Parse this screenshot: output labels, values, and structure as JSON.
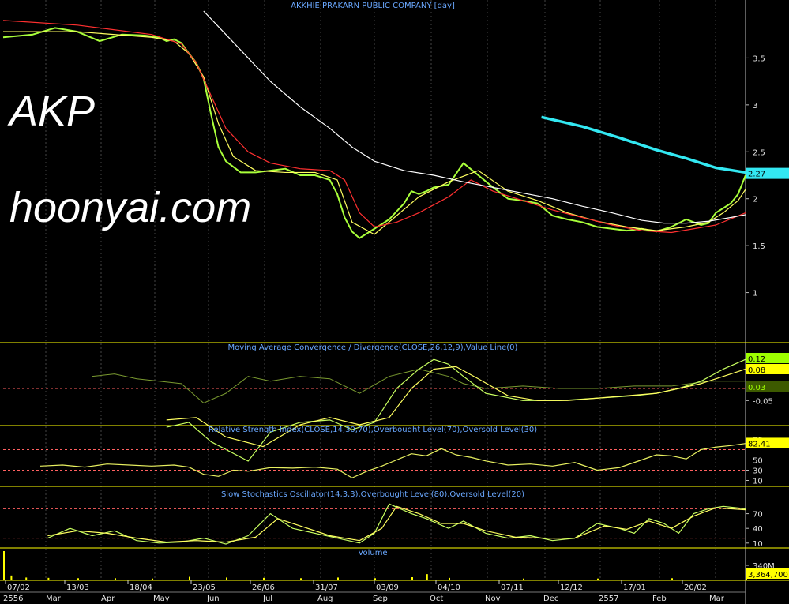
{
  "watermark": {
    "ticker": "AKP",
    "site": "hoonyai.com"
  },
  "chart_data": [
    {
      "type": "line",
      "panel": "price",
      "title": "AKKHIE PRAKARN PUBLIC COMPANY [day]",
      "ylim": [
        0.5,
        4.0
      ],
      "yticks": [
        {
          "v": 3.5,
          "t": "3.5"
        },
        {
          "v": 3,
          "t": "3"
        },
        {
          "v": 2.5,
          "t": "2.5"
        },
        {
          "v": 2,
          "t": "2"
        },
        {
          "v": 1.5,
          "t": "1.5"
        },
        {
          "v": 1,
          "t": "1"
        }
      ],
      "last_value_label": "2.27",
      "last_value": 2.27,
      "series": [
        {
          "role": "close",
          "color": "#a9ff3a",
          "x": [
            0,
            0.04,
            0.07,
            0.1,
            0.13,
            0.16,
            0.19,
            0.21,
            0.22,
            0.23,
            0.24,
            0.25,
            0.26,
            0.27,
            0.28,
            0.29,
            0.3,
            0.32,
            0.34,
            0.36,
            0.38,
            0.4,
            0.42,
            0.44,
            0.45,
            0.46,
            0.47,
            0.48,
            0.5,
            0.52,
            0.54,
            0.55,
            0.56,
            0.57,
            0.58,
            0.6,
            0.62,
            0.64,
            0.66,
            0.68,
            0.7,
            0.72,
            0.74,
            0.76,
            0.78,
            0.8,
            0.82,
            0.84,
            0.86,
            0.88,
            0.9,
            0.92,
            0.94,
            0.95,
            0.96,
            0.97,
            0.98,
            0.99,
            1.0
          ],
          "y": [
            3.72,
            3.75,
            3.82,
            3.78,
            3.68,
            3.75,
            3.74,
            3.72,
            3.68,
            3.7,
            3.66,
            3.55,
            3.45,
            3.28,
            2.9,
            2.55,
            2.4,
            2.28,
            2.28,
            2.3,
            2.32,
            2.25,
            2.25,
            2.2,
            2.05,
            1.8,
            1.65,
            1.58,
            1.68,
            1.78,
            1.95,
            2.08,
            2.05,
            2.08,
            2.12,
            2.15,
            2.38,
            2.25,
            2.12,
            2.0,
            1.98,
            1.95,
            1.82,
            1.78,
            1.75,
            1.7,
            1.68,
            1.66,
            1.68,
            1.65,
            1.7,
            1.78,
            1.72,
            1.74,
            1.85,
            1.9,
            1.95,
            2.05,
            2.25
          ]
        },
        {
          "role": "ma-short",
          "color": "#ffff60",
          "x": [
            0,
            0.1,
            0.2,
            0.23,
            0.25,
            0.27,
            0.29,
            0.31,
            0.34,
            0.38,
            0.42,
            0.45,
            0.47,
            0.5,
            0.53,
            0.56,
            0.58,
            0.6,
            0.64,
            0.68,
            0.72,
            0.76,
            0.8,
            0.84,
            0.88,
            0.92,
            0.95,
            0.97,
            0.99,
            1.0
          ],
          "y": [
            3.78,
            3.78,
            3.72,
            3.68,
            3.55,
            3.3,
            2.8,
            2.45,
            2.3,
            2.28,
            2.28,
            2.2,
            1.75,
            1.62,
            1.82,
            2.02,
            2.1,
            2.18,
            2.3,
            2.08,
            1.98,
            1.85,
            1.76,
            1.7,
            1.66,
            1.7,
            1.75,
            1.85,
            1.98,
            2.1
          ]
        },
        {
          "role": "ma-mid",
          "color": "#ff3030",
          "x": [
            0,
            0.1,
            0.2,
            0.24,
            0.26,
            0.28,
            0.3,
            0.33,
            0.36,
            0.4,
            0.44,
            0.46,
            0.48,
            0.5,
            0.53,
            0.56,
            0.6,
            0.63,
            0.66,
            0.7,
            0.74,
            0.78,
            0.82,
            0.86,
            0.9,
            0.93,
            0.96,
            1.0
          ],
          "y": [
            3.9,
            3.85,
            3.75,
            3.65,
            3.45,
            3.1,
            2.75,
            2.5,
            2.38,
            2.32,
            2.3,
            2.2,
            1.85,
            1.7,
            1.75,
            1.85,
            2.02,
            2.2,
            2.08,
            1.98,
            1.88,
            1.8,
            1.72,
            1.66,
            1.64,
            1.68,
            1.72,
            1.85
          ]
        },
        {
          "role": "ma-long",
          "color": "#ffffff",
          "x": [
            0.27,
            0.3,
            0.33,
            0.36,
            0.4,
            0.44,
            0.47,
            0.5,
            0.54,
            0.58,
            0.62,
            0.66,
            0.7,
            0.74,
            0.78,
            0.82,
            0.86,
            0.89,
            0.92,
            0.95,
            0.98,
            1.0
          ],
          "y": [
            4.0,
            3.75,
            3.5,
            3.25,
            2.98,
            2.75,
            2.55,
            2.4,
            2.3,
            2.25,
            2.18,
            2.12,
            2.06,
            2.0,
            1.92,
            1.85,
            1.77,
            1.74,
            1.74,
            1.76,
            1.8,
            1.83
          ]
        },
        {
          "role": "trend-line",
          "color": "#33e8f2",
          "x": [
            0.725,
            0.78,
            0.83,
            0.88,
            0.92,
            0.96,
            1.0
          ],
          "y": [
            2.87,
            2.77,
            2.65,
            2.52,
            2.43,
            2.33,
            2.28
          ]
        }
      ]
    },
    {
      "type": "line",
      "panel": "macd",
      "title": "Moving Average Convergence / Divergence(CLOSE,26,12,9),Value Line(0)",
      "ylim": [
        -0.15,
        0.15
      ],
      "yticks": [
        {
          "v": -0.05,
          "t": "-0.05"
        }
      ],
      "value_labels": [
        {
          "t": "0.12",
          "v": 0.12,
          "bg": "#9eff00",
          "fg": "#000000"
        },
        {
          "t": "0.08",
          "v": 0.08,
          "bg": "#ffff00",
          "fg": "#000000"
        },
        {
          "t": "0.03",
          "v": 0.03,
          "bg": "#3d5a00",
          "fg": "#9eff00"
        }
      ],
      "reference_line": 0,
      "series": [
        {
          "role": "histogram",
          "color": "#7a9a30",
          "x": [
            0.12,
            0.15,
            0.18,
            0.21,
            0.24,
            0.27,
            0.3,
            0.33,
            0.36,
            0.4,
            0.44,
            0.48,
            0.52,
            0.56,
            0.6,
            0.62,
            0.65,
            0.7,
            0.75,
            0.8,
            0.85,
            0.9,
            0.95,
            1.0
          ],
          "y": [
            0.05,
            0.06,
            0.04,
            0.03,
            0.02,
            -0.06,
            -0.02,
            0.05,
            0.03,
            0.05,
            0.04,
            -0.02,
            0.05,
            0.08,
            0.05,
            0.02,
            0.0,
            0.01,
            0.0,
            0.0,
            0.01,
            0.01,
            0.03,
            0.03
          ]
        },
        {
          "role": "macd",
          "color": "#c8ff60",
          "x": [
            0.22,
            0.25,
            0.28,
            0.33,
            0.36,
            0.4,
            0.44,
            0.47,
            0.5,
            0.53,
            0.56,
            0.58,
            0.6,
            0.62,
            0.65,
            0.7,
            0.75,
            0.8,
            0.85,
            0.88,
            0.91,
            0.94,
            0.97,
            1.0
          ],
          "y": [
            -0.16,
            -0.14,
            -0.22,
            -0.3,
            -0.18,
            -0.14,
            -0.13,
            -0.17,
            -0.14,
            0.0,
            0.08,
            0.12,
            0.1,
            0.05,
            -0.02,
            -0.05,
            -0.05,
            -0.04,
            -0.03,
            -0.02,
            0.0,
            0.03,
            0.08,
            0.12
          ]
        },
        {
          "role": "signal",
          "color": "#ffff60",
          "x": [
            0.22,
            0.26,
            0.3,
            0.35,
            0.4,
            0.44,
            0.48,
            0.52,
            0.55,
            0.58,
            0.61,
            0.64,
            0.68,
            0.72,
            0.76,
            0.8,
            0.84,
            0.88,
            0.91,
            0.94,
            0.97,
            1.0
          ],
          "y": [
            -0.13,
            -0.12,
            -0.2,
            -0.24,
            -0.15,
            -0.12,
            -0.15,
            -0.12,
            0.0,
            0.08,
            0.09,
            0.04,
            -0.03,
            -0.05,
            -0.05,
            -0.04,
            -0.03,
            -0.02,
            0.0,
            0.02,
            0.05,
            0.08
          ]
        }
      ]
    },
    {
      "type": "line",
      "panel": "rsi",
      "title": "Relative Strength Index(CLOSE,14,30,70),Overbought Level(70),Oversold Level(30)",
      "ylim": [
        0,
        100
      ],
      "yticks": [
        {
          "v": 90,
          "t": "90"
        },
        {
          "v": 50,
          "t": "50"
        },
        {
          "v": 30,
          "t": "30"
        },
        {
          "v": 10,
          "t": "10"
        }
      ],
      "value_labels": [
        {
          "t": "82.41",
          "v": 82.41,
          "bg": "#ffff00",
          "fg": "#000000"
        }
      ],
      "levels": [
        70,
        30
      ],
      "series": [
        {
          "role": "rsi",
          "color": "#e8f060",
          "x": [
            0.05,
            0.08,
            0.11,
            0.14,
            0.17,
            0.2,
            0.23,
            0.25,
            0.27,
            0.29,
            0.31,
            0.33,
            0.36,
            0.39,
            0.42,
            0.45,
            0.47,
            0.49,
            0.51,
            0.53,
            0.55,
            0.57,
            0.59,
            0.61,
            0.63,
            0.65,
            0.68,
            0.71,
            0.74,
            0.77,
            0.8,
            0.83,
            0.86,
            0.88,
            0.9,
            0.92,
            0.94,
            0.96,
            0.98,
            1.0
          ],
          "y": [
            38,
            40,
            36,
            42,
            40,
            38,
            40,
            36,
            22,
            18,
            30,
            28,
            35,
            34,
            36,
            32,
            15,
            28,
            38,
            50,
            62,
            58,
            72,
            60,
            55,
            48,
            40,
            42,
            38,
            45,
            30,
            35,
            50,
            60,
            58,
            52,
            70,
            75,
            78,
            82
          ]
        }
      ]
    },
    {
      "type": "line",
      "panel": "stochastic",
      "title": "Slow Stochastics Oscillator(14,3,3),Overbought Level(80),Oversold Level(20)",
      "ylim": [
        0,
        100
      ],
      "yticks": [
        {
          "v": 70,
          "t": "70"
        },
        {
          "v": 40,
          "t": "40"
        },
        {
          "v": 10,
          "t": "10"
        }
      ],
      "levels": [
        80,
        20
      ],
      "series": [
        {
          "role": "%K",
          "color": "#c8ff60",
          "x": [
            0.06,
            0.09,
            0.12,
            0.15,
            0.18,
            0.21,
            0.24,
            0.27,
            0.3,
            0.33,
            0.36,
            0.39,
            0.42,
            0.45,
            0.48,
            0.5,
            0.52,
            0.55,
            0.57,
            0.6,
            0.62,
            0.65,
            0.68,
            0.71,
            0.74,
            0.77,
            0.8,
            0.83,
            0.85,
            0.87,
            0.89,
            0.91,
            0.93,
            0.95,
            0.97,
            1.0
          ],
          "y": [
            20,
            40,
            25,
            35,
            15,
            10,
            12,
            20,
            8,
            25,
            70,
            40,
            30,
            20,
            10,
            30,
            90,
            70,
            60,
            40,
            55,
            30,
            20,
            25,
            15,
            20,
            50,
            40,
            30,
            60,
            50,
            30,
            70,
            80,
            85,
            80
          ]
        },
        {
          "role": "%D",
          "color": "#ffff60",
          "x": [
            0.06,
            0.1,
            0.14,
            0.18,
            0.22,
            0.26,
            0.3,
            0.34,
            0.37,
            0.4,
            0.44,
            0.48,
            0.51,
            0.53,
            0.56,
            0.59,
            0.62,
            0.65,
            0.69,
            0.73,
            0.77,
            0.81,
            0.84,
            0.87,
            0.9,
            0.93,
            0.96,
            1.0
          ],
          "y": [
            25,
            35,
            30,
            20,
            12,
            15,
            12,
            22,
            60,
            45,
            25,
            15,
            40,
            85,
            70,
            50,
            50,
            35,
            22,
            20,
            20,
            45,
            38,
            55,
            40,
            65,
            82,
            78
          ]
        }
      ]
    },
    {
      "type": "bar",
      "panel": "volume",
      "title": "Volume",
      "yticks": [
        {
          "v": 340,
          "t": "340M"
        }
      ],
      "value_labels": [
        {
          "t": "3,364,700",
          "bg": "#ffff00",
          "fg": "#000000"
        }
      ],
      "x": [
        0.0,
        0.01,
        0.03,
        0.06,
        0.1,
        0.15,
        0.2,
        0.25,
        0.3,
        0.35,
        0.4,
        0.45,
        0.5,
        0.55,
        0.57,
        0.6,
        0.7,
        0.8,
        0.9,
        1.0
      ],
      "values": [
        420,
        60,
        30,
        25,
        20,
        20,
        15,
        40,
        30,
        25,
        20,
        30,
        20,
        35,
        80,
        25,
        15,
        15,
        20,
        30
      ]
    }
  ],
  "x_axis": {
    "top_row": [
      "07/02",
      "13/03",
      "18/04",
      "23/05",
      "26/06",
      "31/07",
      "03/09",
      "04/10",
      "07/11",
      "12/12",
      "17/01",
      "20/02"
    ],
    "bottom_row": [
      "2556",
      "Mar",
      "Apr",
      "May",
      "Jun",
      "Jul",
      "Aug",
      "Sep",
      "Oct",
      "Nov",
      "Dec",
      "2557",
      "Feb",
      "Mar"
    ]
  }
}
